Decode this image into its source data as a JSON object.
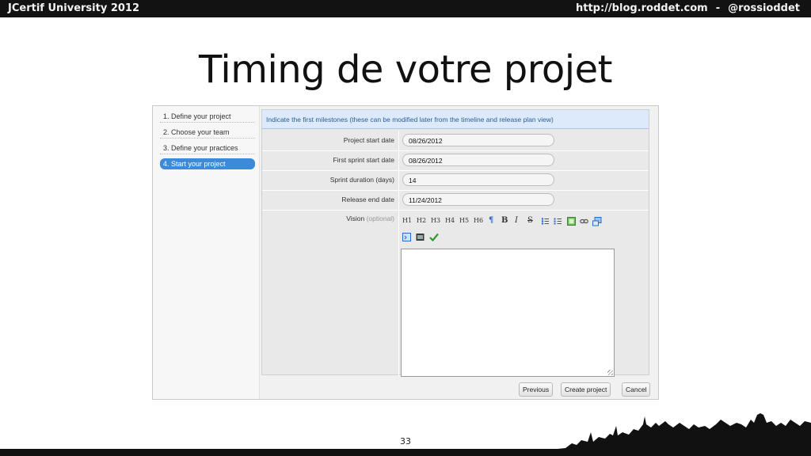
{
  "banner": {
    "left_text": "JCertif University 2012",
    "right_url": "http://blog.roddet.com",
    "right_sep": "-",
    "right_handle": "@rossioddet"
  },
  "slide": {
    "title": "Timing de votre projet",
    "page_number": "33"
  },
  "wizard": {
    "steps": [
      {
        "label": "1. Define your project",
        "active": false
      },
      {
        "label": "2. Choose your team",
        "active": false
      },
      {
        "label": "3. Define your practices",
        "active": false
      },
      {
        "label": "4. Start your project",
        "active": true
      }
    ],
    "info": "Indicate the first milestones (these can be modified later from the timeline and release plan view)",
    "fields": [
      {
        "label": "Project start date",
        "value": "08/26/2012"
      },
      {
        "label": "First sprint start date",
        "value": "08/26/2012"
      },
      {
        "label": "Sprint duration (days)",
        "value": "14"
      },
      {
        "label": "Release end date",
        "value": "11/24/2012"
      }
    ],
    "vision": {
      "label": "Vision",
      "optional": "(optional)"
    },
    "toolbar_headings": [
      "H1",
      "H2",
      "H3",
      "H4",
      "H5",
      "H6"
    ],
    "toolbar_marks": {
      "paragraph": "¶",
      "bold": "B",
      "italic": "I",
      "strike": "S"
    },
    "buttons": {
      "previous": "Previous",
      "create": "Create project",
      "cancel": "Cancel"
    }
  },
  "colors": {
    "accent": "#3d8ad8",
    "info_bg": "#dceafb",
    "check": "#2e9a2e"
  }
}
